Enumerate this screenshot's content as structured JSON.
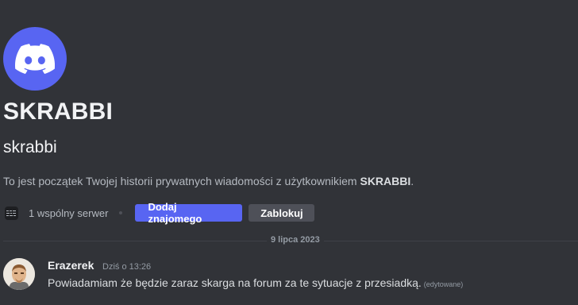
{
  "colors": {
    "background": "#313338",
    "accent": "#5865f2",
    "secondary_button": "#4e5058",
    "muted_text": "#949ba4"
  },
  "profile": {
    "avatar_icon": "discord-logo-icon",
    "display_name": "SKRABBI",
    "username": "skrabbi",
    "intro_prefix": "To jest początek Twojej historii prywatnych wiadomości z użytkownikiem ",
    "intro_name": "SKRABBI",
    "intro_suffix": "."
  },
  "actions": {
    "server_icon": "server-icon",
    "mutual_servers": "1 wspólny serwer",
    "add_friend": "Dodaj znajomego",
    "block": "Zablokuj"
  },
  "divider": {
    "date": "9 lipca 2023"
  },
  "message": {
    "author": "Erazerek",
    "timestamp": "Dziś o 13:26",
    "text": "Powiadamiam że będzie zaraz skarga na forum za te sytuacje z przesiadką.",
    "edited_label": "(edytowane)"
  }
}
